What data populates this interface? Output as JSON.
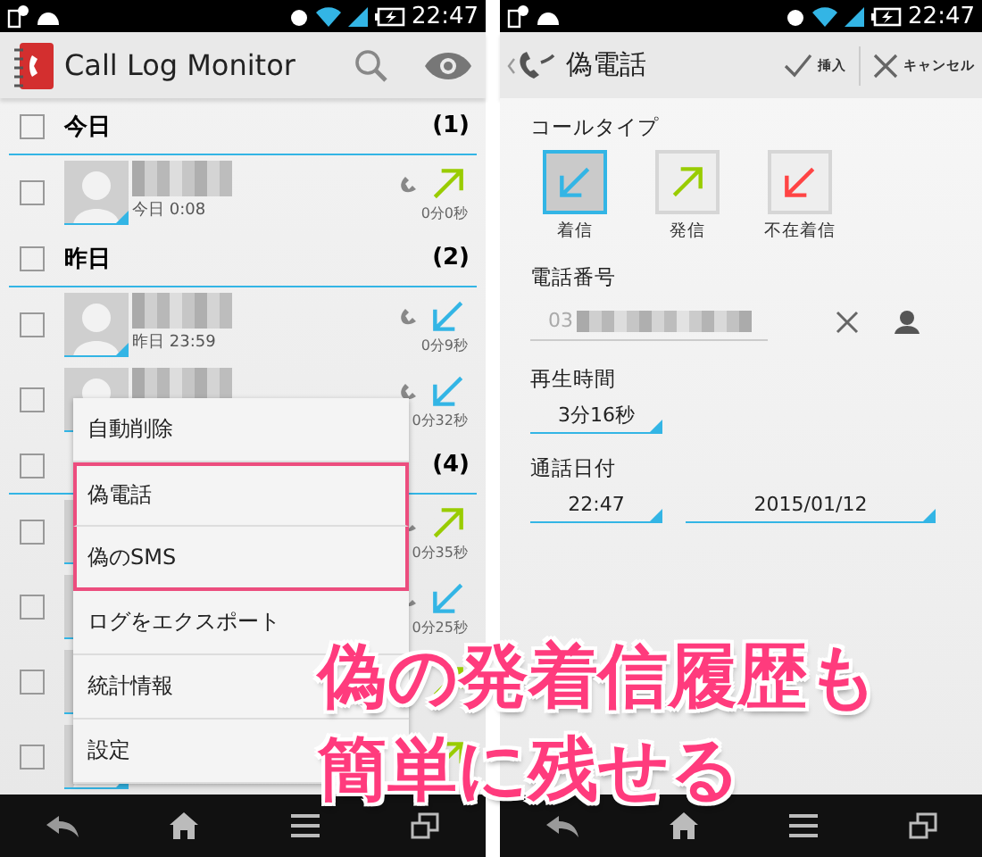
{
  "left_screen": {
    "status_bar": {
      "time": "22:47"
    },
    "action_bar": {
      "title": "Call Log Monitor"
    },
    "groups": [
      {
        "label": "今日",
        "count": "(1)",
        "checked": false,
        "entries": [
          {
            "time": "今日 0:08",
            "duration": "0分0秒",
            "kind": "outgoing",
            "checked": false
          }
        ]
      },
      {
        "label": "昨日",
        "count": "(2)",
        "checked": false,
        "entries": [
          {
            "time": "昨日 23:59",
            "duration": "0分9秒",
            "kind": "incoming",
            "checked": false
          },
          {
            "duration": "0分32秒",
            "kind": "incoming",
            "checked": false
          }
        ]
      },
      {
        "count": "(4)",
        "checked": false,
        "entries": [
          {
            "duration": "0分35秒",
            "kind": "outgoing",
            "checked": false
          },
          {
            "duration": "0分25秒",
            "kind": "incoming",
            "checked": false
          },
          {
            "kind": "outgoing",
            "checked": false
          },
          {
            "kind": "outgoing",
            "checked": false
          }
        ]
      }
    ],
    "menu": [
      {
        "label": "自動削除",
        "highlighted": false
      },
      {
        "label": "偽電話",
        "highlighted": true
      },
      {
        "label": "偽のSMS",
        "highlighted": true
      },
      {
        "label": "ログをエクスポート",
        "highlighted": false
      },
      {
        "label": "統計情報",
        "highlighted": false
      },
      {
        "label": "設定",
        "highlighted": false
      }
    ]
  },
  "right_screen": {
    "status_bar": {
      "time": "22:47"
    },
    "action_bar": {
      "title": "偽電話",
      "actions": [
        {
          "kind": "confirm",
          "label": "挿入"
        },
        {
          "kind": "cancel",
          "label": "キャンセル"
        }
      ]
    },
    "call_type": {
      "label": "コールタイプ",
      "options": [
        {
          "label": "着信",
          "kind": "incoming",
          "selected": true
        },
        {
          "label": "発信",
          "kind": "outgoing",
          "selected": false
        },
        {
          "label": "不在着信",
          "kind": "missed",
          "selected": false
        }
      ]
    },
    "phone_number": {
      "label": "電話番号",
      "value": "03"
    },
    "duration": {
      "label": "再生時間",
      "value": "3分16秒"
    },
    "call_date": {
      "label": "通話日付",
      "time": "22:47",
      "date": "2015/01/12"
    }
  },
  "caption": {
    "lines": [
      "偽の発着信履歴も",
      "簡単に残せる"
    ]
  }
}
